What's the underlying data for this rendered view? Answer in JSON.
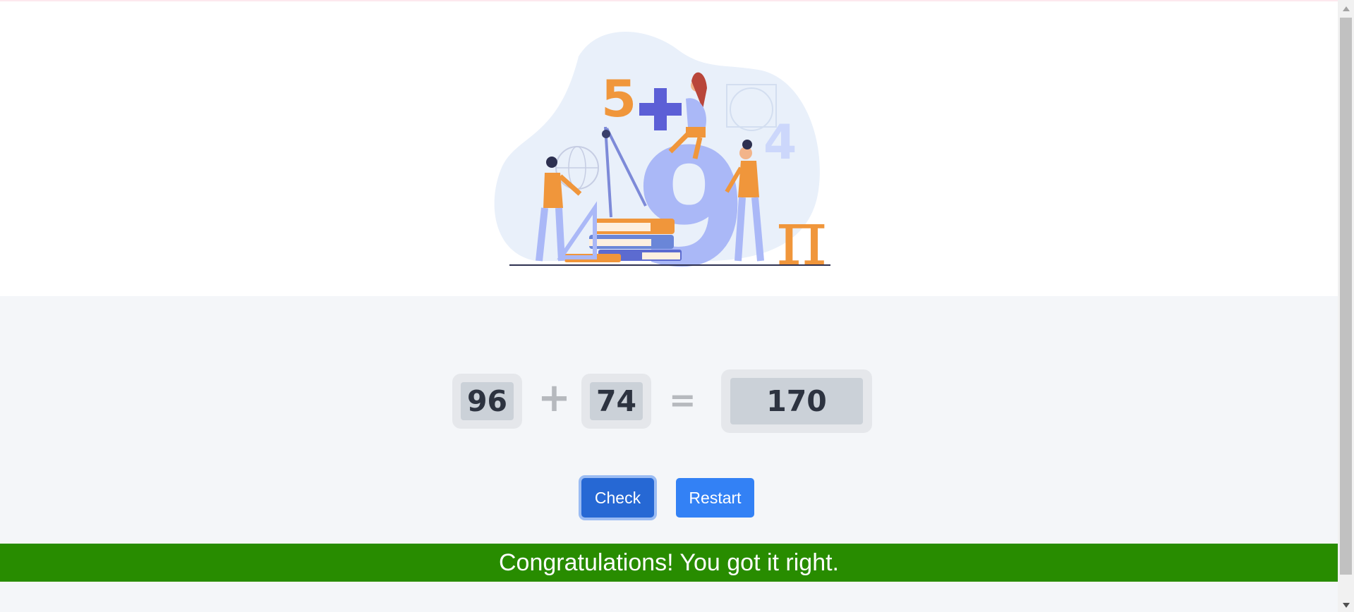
{
  "hero": {
    "illustration": "math-people-illustration"
  },
  "equation": {
    "first_number": "96",
    "operator": "+",
    "second_number": "74",
    "equals": "=",
    "answer_value": "170"
  },
  "buttons": {
    "check_label": "Check",
    "restart_label": "Restart"
  },
  "feedback": {
    "message": "Congratulations! You got it right.",
    "color": "#288c00"
  },
  "colors": {
    "primary": "#3381f5",
    "primary_active": "#2668d4",
    "success": "#288c00",
    "illustration_orange": "#f0963b",
    "illustration_blue": "#aab8f7"
  }
}
